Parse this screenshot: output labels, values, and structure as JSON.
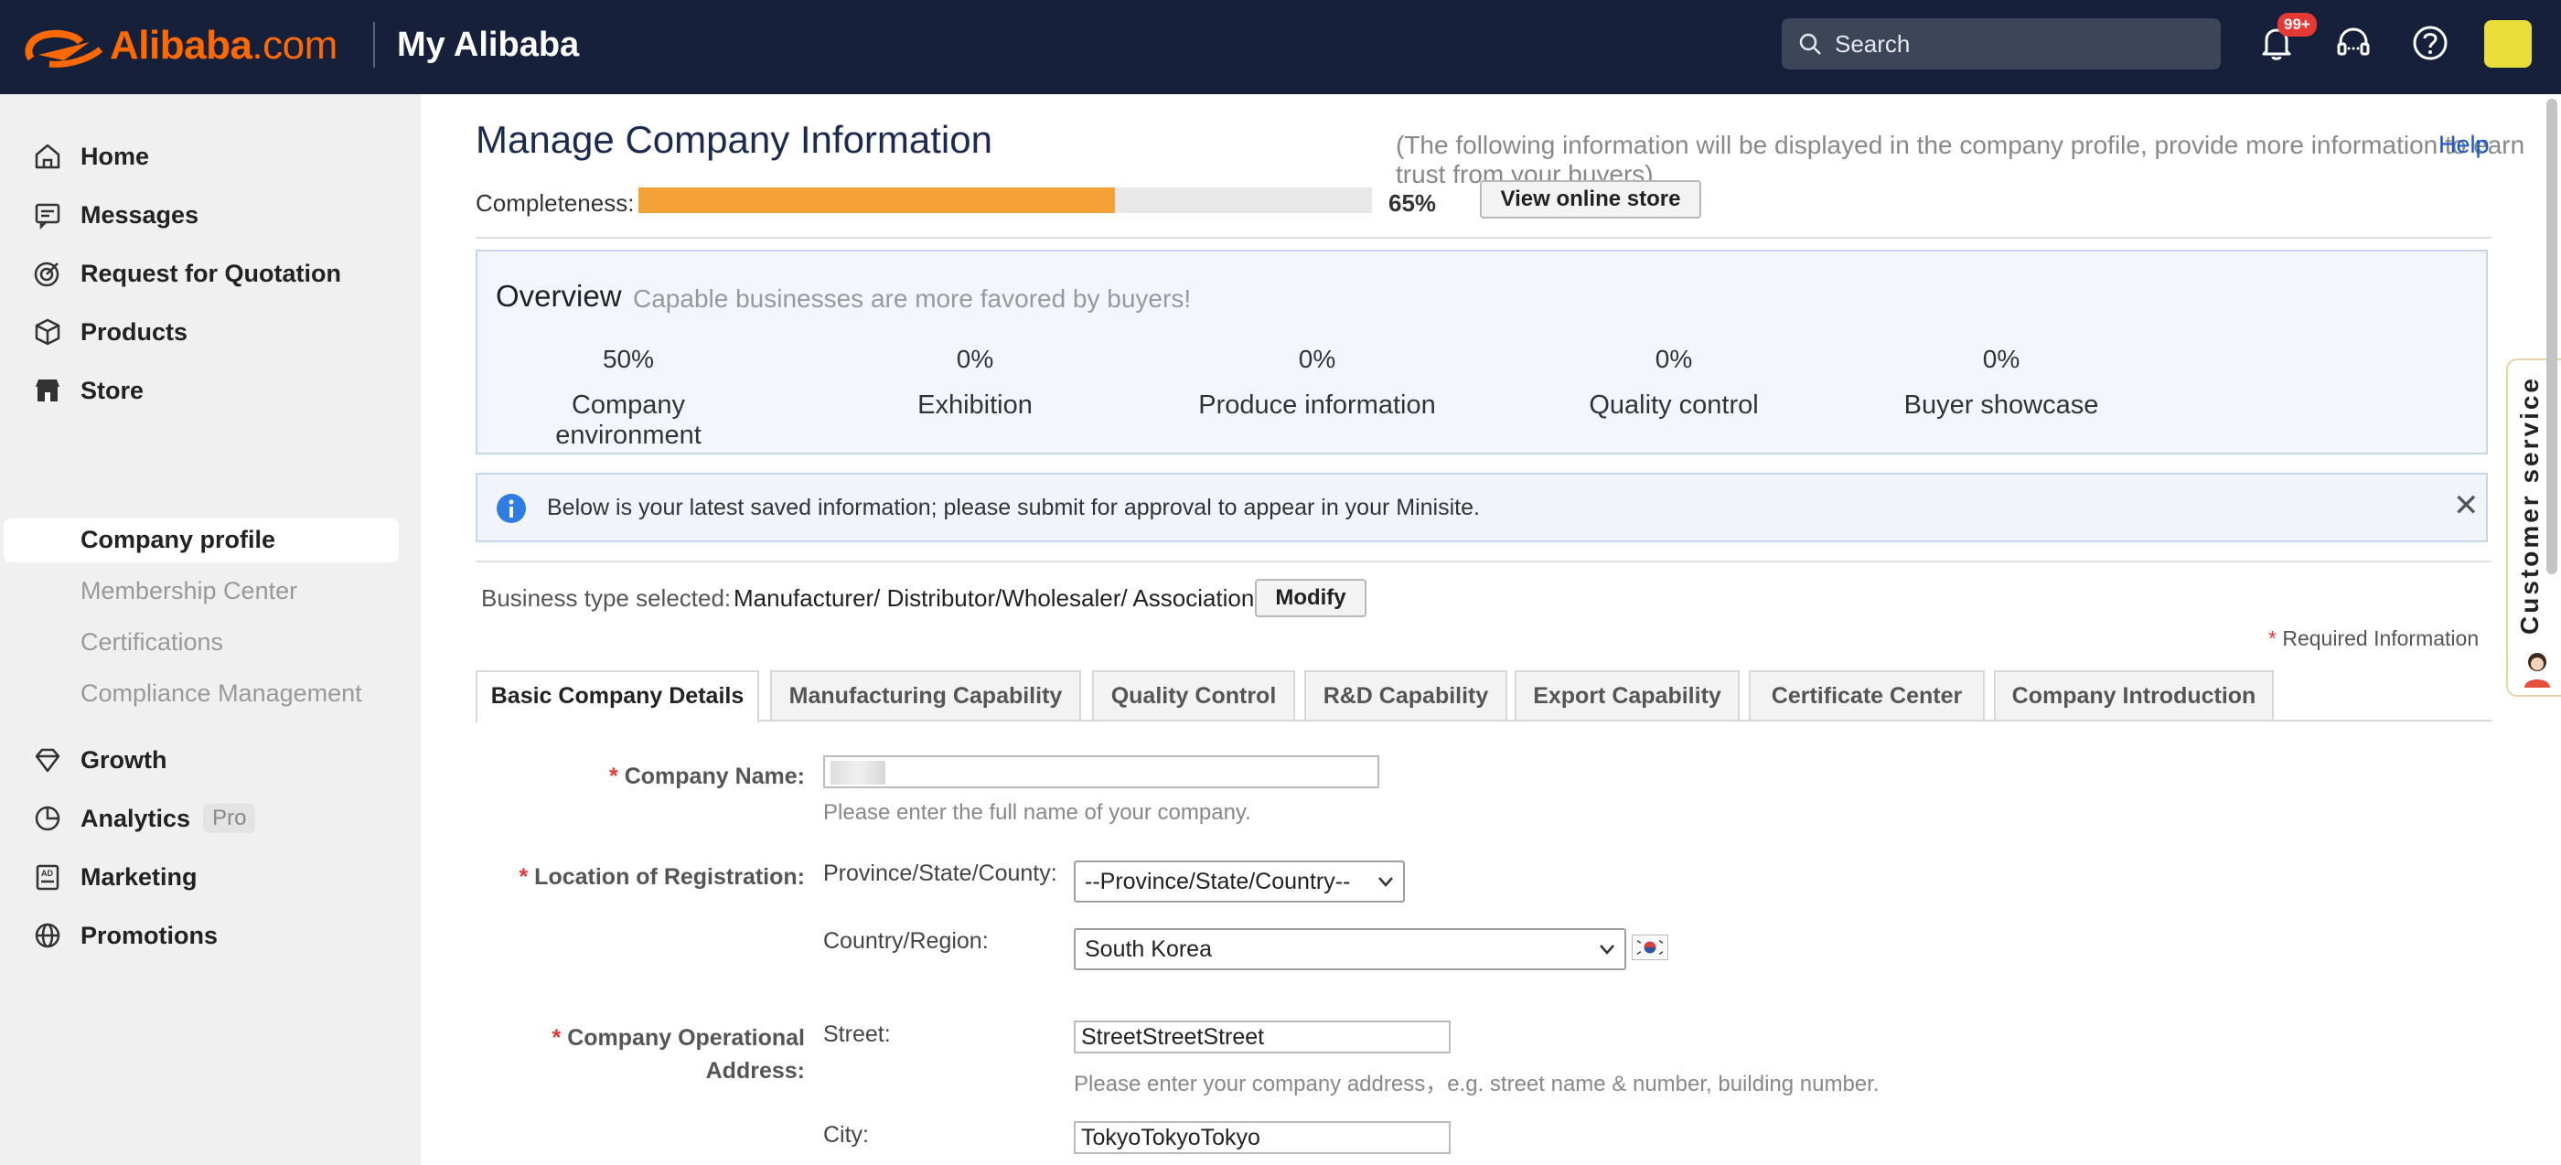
{
  "header": {
    "logo_text": "Alibaba",
    "logo_dotcom": ".com",
    "section_title": "My Alibaba",
    "search_placeholder": "Search",
    "notification_badge": "99+"
  },
  "sidebar": {
    "items": [
      {
        "label": "Home",
        "icon": "home-icon"
      },
      {
        "label": "Messages",
        "icon": "message-icon"
      },
      {
        "label": "Request for Quotation",
        "icon": "target-icon"
      },
      {
        "label": "Products",
        "icon": "box-icon"
      },
      {
        "label": "Store",
        "icon": "store-icon"
      }
    ],
    "store_sub": [
      {
        "label": "Company profile",
        "active": true
      },
      {
        "label": "Membership Center"
      },
      {
        "label": "Certifications"
      },
      {
        "label": "Compliance Management"
      }
    ],
    "items2": [
      {
        "label": "Growth",
        "icon": "diamond-icon"
      },
      {
        "label": "Analytics",
        "icon": "pie-chart-icon",
        "tag": "Pro"
      },
      {
        "label": "Marketing",
        "icon": "marketing-icon"
      },
      {
        "label": "Promotions",
        "icon": "globe-icon"
      }
    ]
  },
  "main": {
    "title": "Manage Company Information",
    "subtitle": "(The following information will be displayed in the company profile, provide more information to earn trust from your buyers)",
    "help": "Help",
    "completeness_label": "Completeness:",
    "completeness_value": 0.65,
    "completeness_pct": "65%",
    "view_store": "View online store",
    "overview": {
      "title": "Overview",
      "subtitle": "Capable businesses are more favored by buyers!",
      "items": [
        {
          "pct": "50%",
          "name": "Company environment"
        },
        {
          "pct": "0%",
          "name": "Exhibition"
        },
        {
          "pct": "0%",
          "name": "Produce information"
        },
        {
          "pct": "0%",
          "name": "Quality control"
        },
        {
          "pct": "0%",
          "name": "Buyer showcase"
        }
      ]
    },
    "notice": "Below is your latest saved information; please submit for approval to appear in your Minisite.",
    "business_type_label": "Business type selected:",
    "business_type_value": "Manufacturer/ Distributor/Wholesaler/ Association",
    "modify": "Modify",
    "required_info": "Required Information",
    "required_star": "*",
    "tabs": [
      "Basic Company Details",
      "Manufacturing Capability",
      "Quality Control",
      "R&D Capability",
      "Export Capability",
      "Certificate Center",
      "Company Introduction"
    ],
    "form": {
      "company_name_label": "Company Name:",
      "company_name_hint": "Please enter the full name of your company.",
      "location_label": "Location of Registration:",
      "province_label": "Province/State/County:",
      "province_value": "--Province/State/Country--",
      "country_label": "Country/Region:",
      "country_value": "South Korea",
      "address_label_1": "Company Operational",
      "address_label_2": "Address:",
      "street_label": "Street:",
      "street_value": "StreetStreetStreet",
      "street_hint": "Please enter your company address，e.g. street name & number, building number.",
      "city_label": "City:",
      "city_value": "TokyoTokyoTokyo"
    }
  },
  "customer_service": "Customer service",
  "colors": {
    "header_bg": "#16203a",
    "brand_orange": "#ff6a00",
    "progress_fill": "#f4a138",
    "link_blue": "#1a56c9",
    "required_red": "#e53935"
  }
}
